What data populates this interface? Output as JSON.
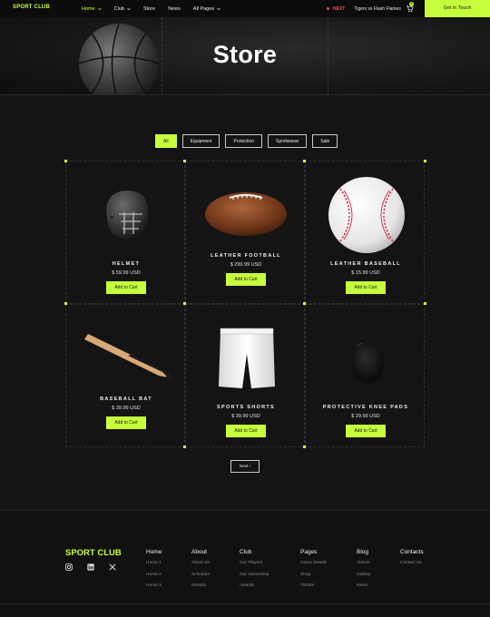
{
  "nav": {
    "brand": "SPORT CLUB",
    "items": [
      {
        "label": "Home",
        "has_dropdown": true,
        "active": true
      },
      {
        "label": "Club",
        "has_dropdown": true,
        "active": false
      },
      {
        "label": "Store",
        "has_dropdown": false,
        "active": false
      },
      {
        "label": "News",
        "has_dropdown": false,
        "active": false
      },
      {
        "label": "All Pages",
        "has_dropdown": true,
        "active": false
      }
    ],
    "next_label": "NEXT",
    "next_match": "Tigers vs Flash Flames",
    "cart_count": "0",
    "cta": "Get in Touch"
  },
  "hero": {
    "title": "Store"
  },
  "filters": [
    "All",
    "Equipment",
    "Protection",
    "Sportswear",
    "Sale"
  ],
  "products": [
    {
      "name": "HELMET",
      "price": "$ 59.99 USD",
      "button": "Add to Cart",
      "image": "helmet"
    },
    {
      "name": "LEATHER FOOTBALL",
      "price": "$ 299.99 USD",
      "button": "Add to Cart",
      "image": "football"
    },
    {
      "name": "LEATHER BASEBALL",
      "price": "$ 15.99 USD",
      "button": "Add to Cart",
      "image": "baseball"
    },
    {
      "name": "BASEBALL BAT",
      "price": "$ 39.99 USD",
      "button": "Add to Cart",
      "image": "bat"
    },
    {
      "name": "SPORTS SHORTS",
      "price": "$ 39.99 USD",
      "button": "Add to Cart",
      "image": "shorts"
    },
    {
      "name": "PROTECTIVE KNEE PADS",
      "price": "$ 29.99 USD",
      "button": "Add to Cart",
      "image": "kneepads"
    }
  ],
  "pagination": {
    "next": "Next"
  },
  "footer": {
    "brand": "SPORT CLUB",
    "socials": [
      "instagram-icon",
      "linkedin-icon",
      "x-icon"
    ],
    "columns": [
      {
        "title": "Home",
        "links": [
          "Home 1",
          "Home 2",
          "Home 3"
        ]
      },
      {
        "title": "About",
        "links": [
          "About Us",
          "Schedule",
          "Results"
        ]
      },
      {
        "title": "Club",
        "links": [
          "Our Players",
          "Our Ownership",
          "Awards"
        ]
      },
      {
        "title": "Pages",
        "links": [
          "Game Details",
          "Shop",
          "Tickets"
        ]
      },
      {
        "title": "Blog",
        "links": [
          "Videos",
          "Gallery",
          "News"
        ]
      },
      {
        "title": "Contacts",
        "links": [
          "Contact Us"
        ]
      }
    ]
  },
  "colors": {
    "accent": "#c6ff3d",
    "background": "#141414",
    "next_red": "#ff4b4b"
  }
}
